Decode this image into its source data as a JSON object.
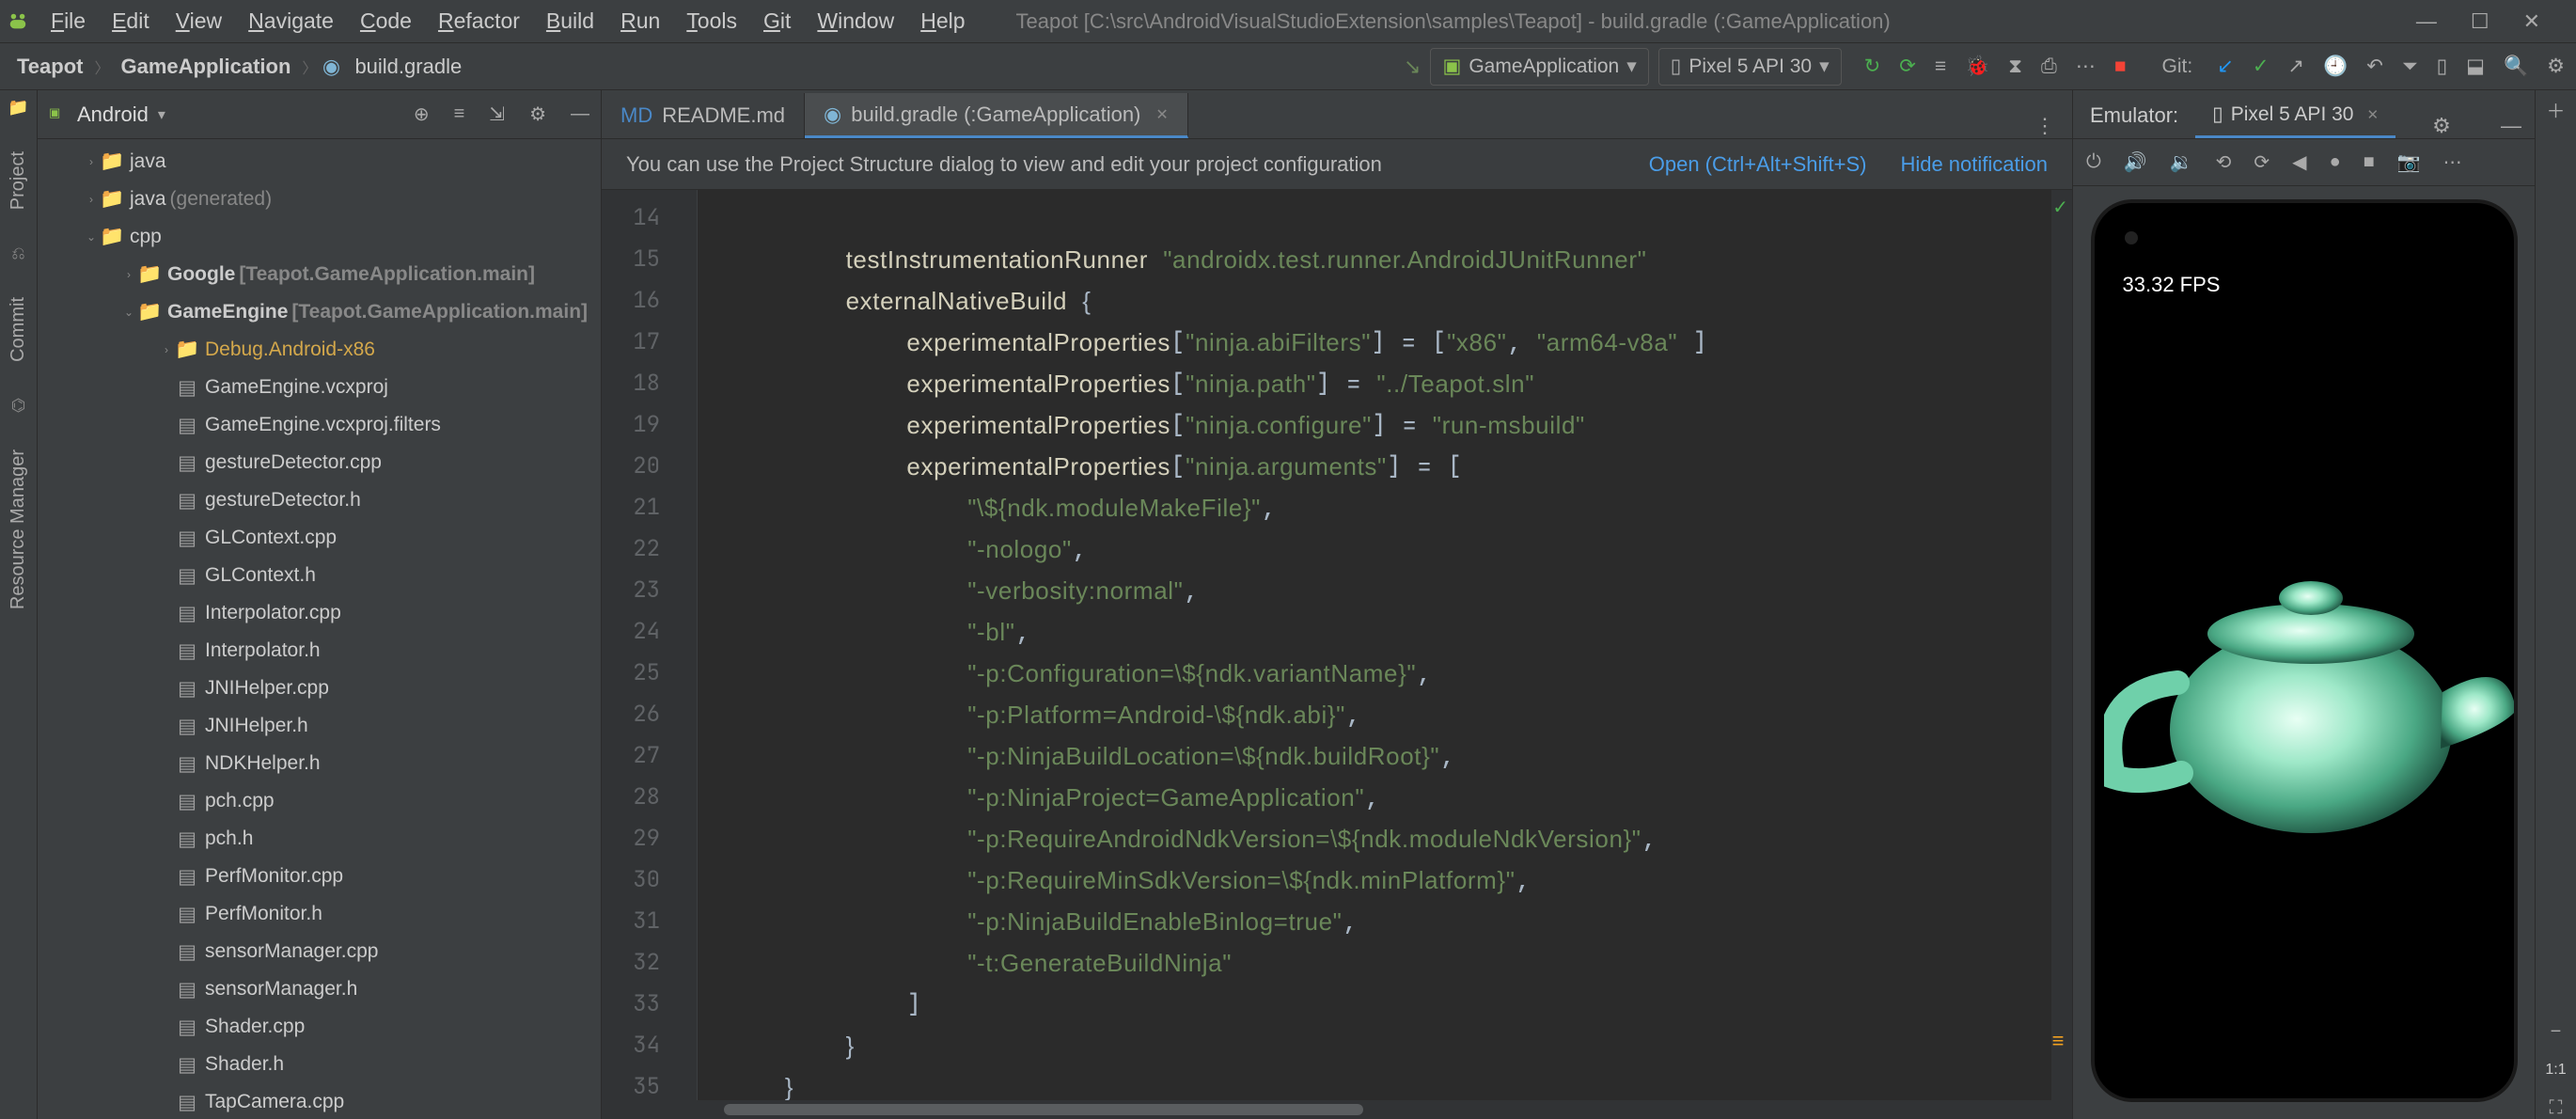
{
  "menu": {
    "items": [
      "File",
      "Edit",
      "View",
      "Navigate",
      "Code",
      "Refactor",
      "Build",
      "Run",
      "Tools",
      "Git",
      "Window",
      "Help"
    ],
    "title": "Teapot [C:\\src\\AndroidVisualStudioExtension\\samples\\Teapot] - build.gradle (:GameApplication)"
  },
  "breadcrumb": {
    "p0": "Teapot",
    "p1": "GameApplication",
    "p2": "build.gradle"
  },
  "run": {
    "config": "GameApplication",
    "device": "Pixel 5 API 30",
    "git_label": "Git:"
  },
  "project": {
    "mode": "Android",
    "tree": [
      {
        "depth": 1,
        "type": "folder",
        "name": "java",
        "exp": "›",
        "icon": "📁",
        "cls": "folder-blue"
      },
      {
        "depth": 1,
        "type": "folder",
        "name": "java",
        "extra": " (generated)",
        "exp": "›",
        "icon": "📁",
        "cls": "folder-blue"
      },
      {
        "depth": 1,
        "type": "folder",
        "name": "cpp",
        "exp": "⌄",
        "icon": "📁",
        "cls": "folder-blue"
      },
      {
        "depth": 2,
        "type": "folder",
        "name": "Google ",
        "extra": "[Teapot.GameApplication.main]",
        "exp": "›",
        "icon": "📁",
        "cls": "folder-grey",
        "bold": true
      },
      {
        "depth": 2,
        "type": "folder",
        "name": "GameEngine ",
        "extra": "[Teapot.GameApplication.main]",
        "exp": "⌄",
        "icon": "📁",
        "cls": "folder-grey",
        "bold": true
      },
      {
        "depth": 3,
        "type": "folder",
        "name": "Debug.Android-x86",
        "exp": "›",
        "icon": "📁",
        "cls": "folder-grey",
        "highlight": true
      },
      {
        "depth": 3,
        "type": "file",
        "name": "GameEngine.vcxproj"
      },
      {
        "depth": 3,
        "type": "file",
        "name": "GameEngine.vcxproj.filters"
      },
      {
        "depth": 3,
        "type": "file",
        "name": "gestureDetector.cpp"
      },
      {
        "depth": 3,
        "type": "file",
        "name": "gestureDetector.h"
      },
      {
        "depth": 3,
        "type": "file",
        "name": "GLContext.cpp"
      },
      {
        "depth": 3,
        "type": "file",
        "name": "GLContext.h"
      },
      {
        "depth": 3,
        "type": "file",
        "name": "Interpolator.cpp"
      },
      {
        "depth": 3,
        "type": "file",
        "name": "Interpolator.h"
      },
      {
        "depth": 3,
        "type": "file",
        "name": "JNIHelper.cpp"
      },
      {
        "depth": 3,
        "type": "file",
        "name": "JNIHelper.h"
      },
      {
        "depth": 3,
        "type": "file",
        "name": "NDKHelper.h"
      },
      {
        "depth": 3,
        "type": "file",
        "name": "pch.cpp"
      },
      {
        "depth": 3,
        "type": "file",
        "name": "pch.h"
      },
      {
        "depth": 3,
        "type": "file",
        "name": "PerfMonitor.cpp"
      },
      {
        "depth": 3,
        "type": "file",
        "name": "PerfMonitor.h"
      },
      {
        "depth": 3,
        "type": "file",
        "name": "sensorManager.cpp"
      },
      {
        "depth": 3,
        "type": "file",
        "name": "sensorManager.h"
      },
      {
        "depth": 3,
        "type": "file",
        "name": "Shader.cpp"
      },
      {
        "depth": 3,
        "type": "file",
        "name": "Shader.h"
      },
      {
        "depth": 3,
        "type": "file",
        "name": "TapCamera.cpp"
      }
    ]
  },
  "editor": {
    "tabs": [
      {
        "label": "README.md",
        "active": false,
        "icon": "MD"
      },
      {
        "label": "build.gradle (:GameApplication)",
        "active": true,
        "icon": "gradle"
      }
    ],
    "notification": {
      "msg": "You can use the Project Structure dialog to view and edit your project configuration",
      "link1": "Open (Ctrl+Alt+Shift+S)",
      "link2": "Hide notification"
    },
    "first_line": 14,
    "code_lines_display": [
      "",
      "        testInstrumentationRunner \"androidx.test.runner.AndroidJUnitRunner\"",
      "        externalNativeBuild {",
      "            experimentalProperties[\"ninja.abiFilters\"] = [\"x86\", \"arm64-v8a\" ]",
      "            experimentalProperties[\"ninja.path\"] = \"../Teapot.sln\"",
      "            experimentalProperties[\"ninja.configure\"] = \"run-msbuild\"",
      "            experimentalProperties[\"ninja.arguments\"] = [",
      "                \"\\${ndk.moduleMakeFile}\",",
      "                \"-nologo\",",
      "                \"-verbosity:normal\",",
      "                \"-bl\",",
      "                \"-p:Configuration=\\${ndk.variantName}\",",
      "                \"-p:Platform=Android-\\${ndk.abi}\",",
      "                \"-p:NinjaBuildLocation=\\${ndk.buildRoot}\",",
      "                \"-p:NinjaProject=GameApplication\",",
      "                \"-p:RequireAndroidNdkVersion=\\${ndk.moduleNdkVersion}\",",
      "                \"-p:RequireMinSdkVersion=\\${ndk.minPlatform}\",",
      "                \"-p:NinjaBuildEnableBinlog=true\",",
      "                \"-t:GenerateBuildNinja\"",
      "            ]",
      "        }",
      "    }"
    ],
    "strings": {
      "runner": "androidx.test.runner.AndroidJUnitRunner",
      "abi_key": "ninja.abiFilters",
      "abi_v1": "x86",
      "abi_v2": "arm64-v8a",
      "path_key": "ninja.path",
      "path_v": "../Teapot.sln",
      "conf_key": "ninja.configure",
      "conf_v": "run-msbuild",
      "args_key": "ninja.arguments",
      "a0": "\\${ndk.moduleMakeFile}",
      "a1": "-nologo",
      "a2": "-verbosity:normal",
      "a3": "-bl",
      "a4": "-p:Configuration=\\${ndk.variantName}",
      "a5": "-p:Platform=Android-\\${ndk.abi}",
      "a6": "-p:NinjaBuildLocation=\\${ndk.buildRoot}",
      "a7": "-p:NinjaProject=GameApplication",
      "a8": "-p:RequireAndroidNdkVersion=\\${ndk.moduleNdkVersion}",
      "a9": "-p:RequireMinSdkVersion=\\${ndk.minPlatform}",
      "a10": "-p:NinjaBuildEnableBinlog=true",
      "a11": "-t:GenerateBuildNinja"
    },
    "idents": {
      "tir": "testInstrumentationRunner",
      "enb": "externalNativeBuild",
      "ep": "experimentalProperties"
    }
  },
  "emulator": {
    "header": "Emulator:",
    "device_tab": "Pixel 5 API 30",
    "fps": "33.32 FPS",
    "ratio": "1:1"
  },
  "left_strips": {
    "project": "Project",
    "commit": "Commit",
    "rm": "Resource Manager"
  }
}
